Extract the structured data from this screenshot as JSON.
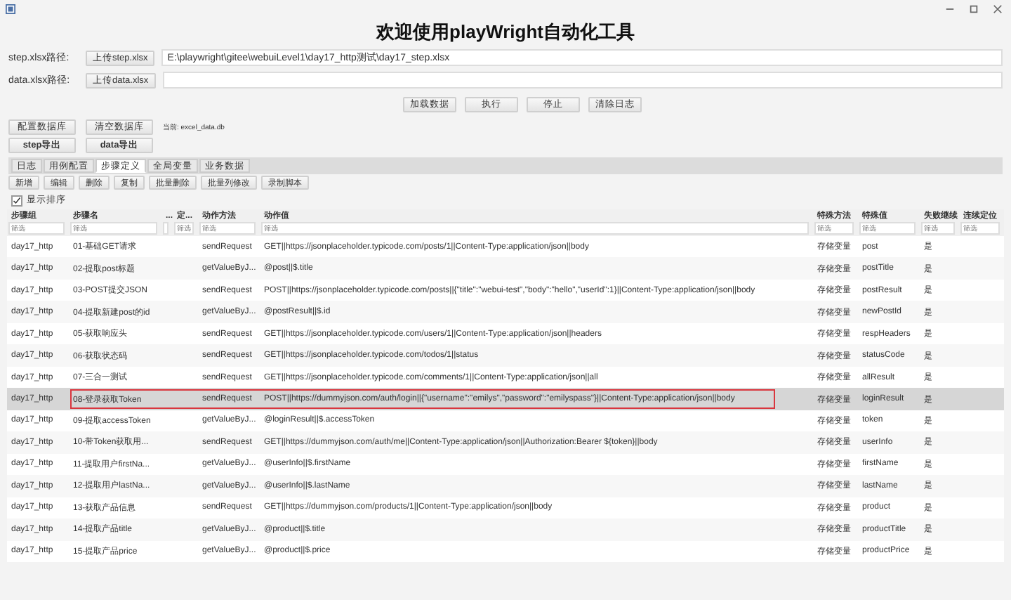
{
  "window": {
    "title": "欢迎使用playWright自动化工具"
  },
  "paths": [
    {
      "label": "step.xlsx路径:",
      "button": "上传step.xlsx",
      "value": "E:\\playwright\\gitee\\webuiLevel1\\day17_http测试\\day17_step.xlsx"
    },
    {
      "label": "data.xlsx路径:",
      "button": "上传data.xlsx"
    }
  ],
  "actions": [
    "加载数据",
    "执行",
    "停止",
    "清除日志"
  ],
  "db_buttons": [
    "配置数据库",
    "清空数据库"
  ],
  "db_status": "当前: excel_data.db",
  "export_buttons": [
    "step导出",
    "data导出"
  ],
  "tabs": [
    {
      "label": "日志",
      "selected": false
    },
    {
      "label": "用例配置",
      "selected": false
    },
    {
      "label": "步骤定义",
      "selected": true
    },
    {
      "label": "全局变量",
      "selected": false
    },
    {
      "label": "业务数据",
      "selected": false
    }
  ],
  "toolbar": [
    "新增",
    "编辑",
    "删除",
    "复制",
    "批量删除",
    "批量列修改",
    "录制脚本"
  ],
  "show_sort": {
    "label": "显示排序",
    "checked": true
  },
  "table": {
    "columns": [
      {
        "label": "步骤组",
        "placeholder": "筛选"
      },
      {
        "label": "步骤名",
        "placeholder": "筛选"
      },
      {
        "label": "..."
      },
      {
        "label": "定...",
        "placeholder": "筛选"
      },
      {
        "label": "动作方法",
        "placeholder": "筛选"
      },
      {
        "label": "动作值",
        "placeholder": "筛选"
      },
      {
        "label": "特殊方法",
        "placeholder": "筛选"
      },
      {
        "label": "特殊值",
        "placeholder": "筛选"
      },
      {
        "label": "失败继续",
        "placeholder": "筛选"
      },
      {
        "label": "连续定位",
        "placeholder": "筛选"
      }
    ],
    "rows": [
      {
        "selected": false,
        "outlined": false,
        "cells": [
          "day17_http",
          "01-基础GET请求",
          "",
          "",
          "sendRequest",
          "GET||https://jsonplaceholder.typicode.com/posts/1||Content-Type:application/json||body",
          "存储变量",
          "post",
          "是",
          ""
        ]
      },
      {
        "selected": false,
        "outlined": false,
        "cells": [
          "day17_http",
          "02-提取post标题",
          "",
          "",
          "getValueByJ...",
          "@post||$.title",
          "存储变量",
          "postTitle",
          "是",
          ""
        ]
      },
      {
        "selected": false,
        "outlined": false,
        "cells": [
          "day17_http",
          "03-POST提交JSON",
          "",
          "",
          "sendRequest",
          "POST||https://jsonplaceholder.typicode.com/posts||{\"title\":\"webui-test\",\"body\":\"hello\",\"userId\":1}||Content-Type:application/json||body",
          "存储变量",
          "postResult",
          "是",
          ""
        ]
      },
      {
        "selected": false,
        "outlined": false,
        "cells": [
          "day17_http",
          "04-提取新建post的id",
          "",
          "",
          "getValueByJ...",
          "@postResult||$.id",
          "存储变量",
          "newPostId",
          "是",
          ""
        ]
      },
      {
        "selected": false,
        "outlined": false,
        "cells": [
          "day17_http",
          "05-获取响应头",
          "",
          "",
          "sendRequest",
          "GET||https://jsonplaceholder.typicode.com/users/1||Content-Type:application/json||headers",
          "存储变量",
          "respHeaders",
          "是",
          ""
        ]
      },
      {
        "selected": false,
        "outlined": false,
        "cells": [
          "day17_http",
          "06-获取状态码",
          "",
          "",
          "sendRequest",
          "GET||https://jsonplaceholder.typicode.com/todos/1||status",
          "存储变量",
          "statusCode",
          "是",
          ""
        ]
      },
      {
        "selected": false,
        "outlined": false,
        "cells": [
          "day17_http",
          "07-三合一测试",
          "",
          "",
          "sendRequest",
          "GET||https://jsonplaceholder.typicode.com/comments/1||Content-Type:application/json||all",
          "存储变量",
          "allResult",
          "是",
          ""
        ]
      },
      {
        "selected": true,
        "outlined": true,
        "cells": [
          "day17_http",
          "08-登录获取Token",
          "",
          "",
          "sendRequest",
          "POST||https://dummyjson.com/auth/login||{\"username\":\"emilys\",\"password\":\"emilyspass\"}||Content-Type:application/json||body",
          "存储变量",
          "loginResult",
          "是",
          ""
        ]
      },
      {
        "selected": false,
        "outlined": false,
        "cells": [
          "day17_http",
          "09-提取accessToken",
          "",
          "",
          "getValueByJ...",
          "@loginResult||$.accessToken",
          "存储变量",
          "token",
          "是",
          ""
        ]
      },
      {
        "selected": false,
        "outlined": false,
        "cells": [
          "day17_http",
          "10-带Token获取用...",
          "",
          "",
          "sendRequest",
          "GET||https://dummyjson.com/auth/me||Content-Type:application/json||Authorization:Bearer ${token}||body",
          "存储变量",
          "userInfo",
          "是",
          ""
        ]
      },
      {
        "selected": false,
        "outlined": false,
        "cells": [
          "day17_http",
          "11-提取用户firstNa...",
          "",
          "",
          "getValueByJ...",
          "@userInfo||$.firstName",
          "存储变量",
          "firstName",
          "是",
          ""
        ]
      },
      {
        "selected": false,
        "outlined": false,
        "cells": [
          "day17_http",
          "12-提取用户lastNa...",
          "",
          "",
          "getValueByJ...",
          "@userInfo||$.lastName",
          "存储变量",
          "lastName",
          "是",
          ""
        ]
      },
      {
        "selected": false,
        "outlined": false,
        "cells": [
          "day17_http",
          "13-获取产品信息",
          "",
          "",
          "sendRequest",
          "GET||https://dummyjson.com/products/1||Content-Type:application/json||body",
          "存储变量",
          "product",
          "是",
          ""
        ]
      },
      {
        "selected": false,
        "outlined": false,
        "cells": [
          "day17_http",
          "14-提取产品title",
          "",
          "",
          "getValueByJ...",
          "@product||$.title",
          "存储变量",
          "productTitle",
          "是",
          ""
        ]
      },
      {
        "selected": false,
        "outlined": false,
        "cells": [
          "day17_http",
          "15-提取产品price",
          "",
          "",
          "getValueByJ...",
          "@product||$.price",
          "存储变量",
          "productPrice",
          "是",
          ""
        ]
      }
    ]
  }
}
